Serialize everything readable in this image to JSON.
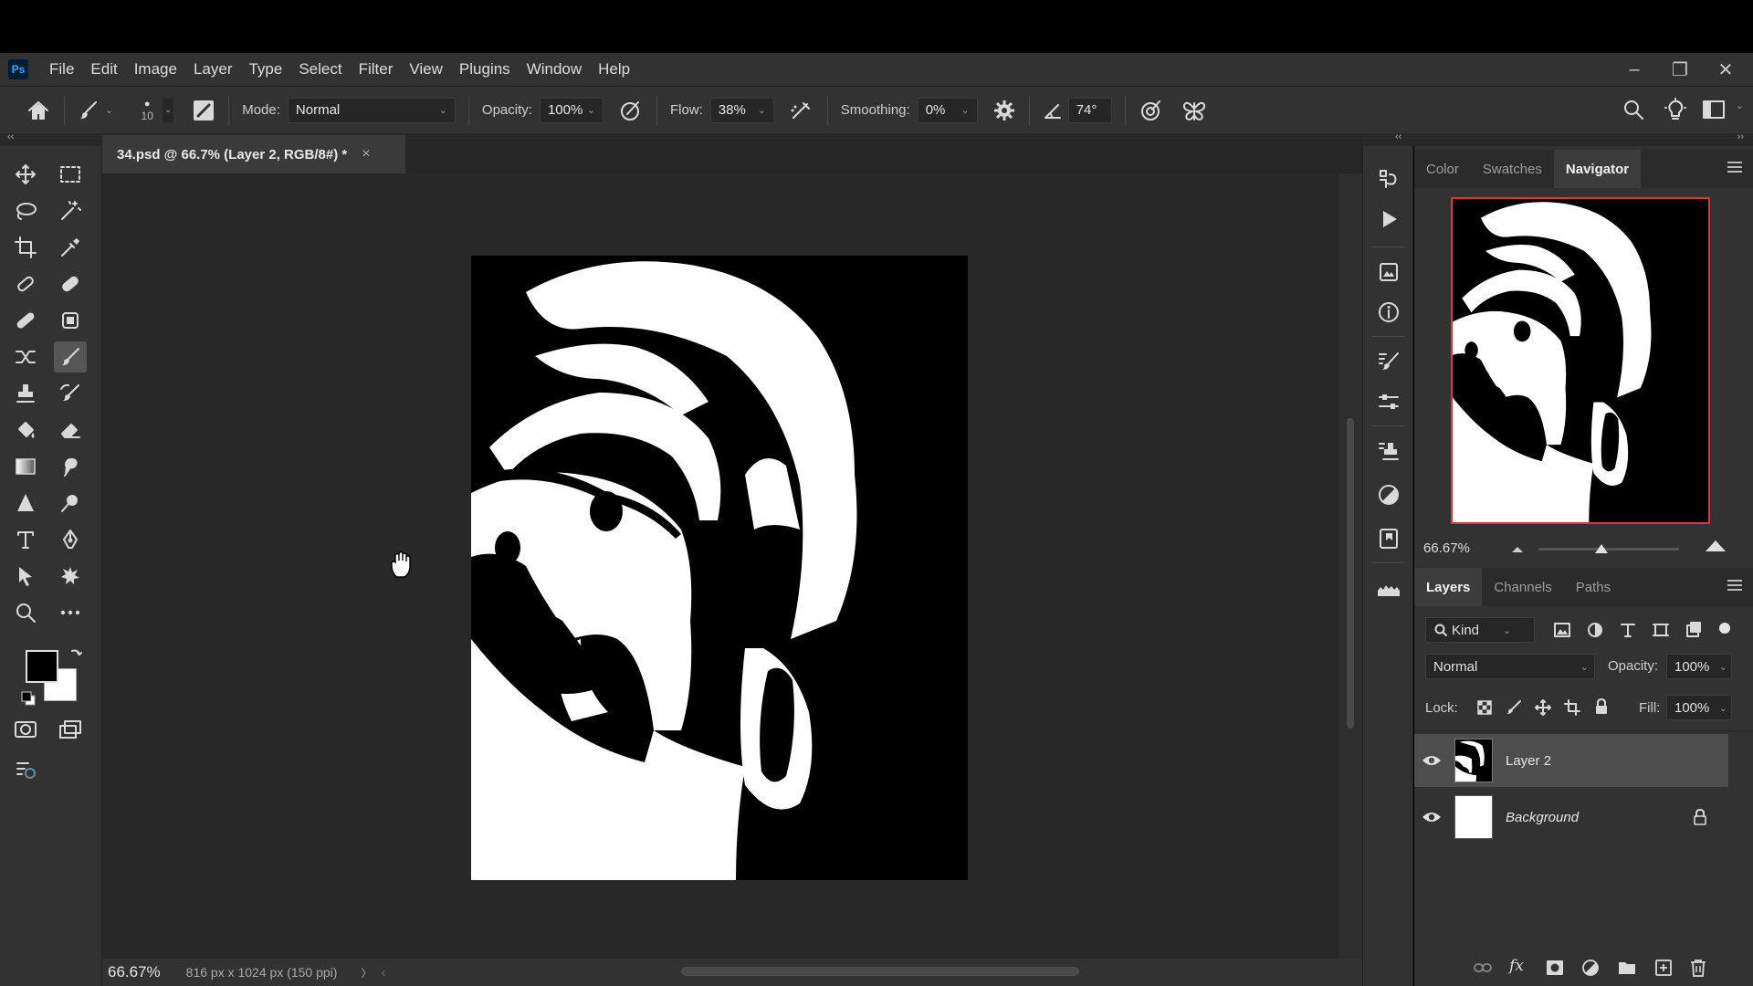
{
  "app": {
    "logo_text": "Ps",
    "menu": [
      "File",
      "Edit",
      "Image",
      "Layer",
      "Type",
      "Select",
      "Filter",
      "View",
      "Plugins",
      "Window",
      "Help"
    ]
  },
  "options": {
    "brush_size": "10",
    "mode_label": "Mode:",
    "mode_value": "Normal",
    "opacity_label": "Opacity:",
    "opacity_value": "100%",
    "flow_label": "Flow:",
    "flow_value": "38%",
    "smoothing_label": "Smoothing:",
    "smoothing_value": "0%",
    "angle_value": "74°"
  },
  "document": {
    "tab_title": "34.psd @ 66.7% (Layer 2, RGB/8#) *",
    "close_glyph": "×"
  },
  "status": {
    "zoom": "66.67%",
    "doc_info": "816 px x 1024 px (150 ppi)",
    "nav_arrow": "〉",
    "left_arrow": "‹"
  },
  "panels": {
    "top_tabs": [
      "Color",
      "Swatches",
      "Navigator"
    ],
    "navigator_zoom": "66.67%",
    "navigator_zoom_fraction": 0.45,
    "layer_tabs": [
      "Layers",
      "Channels",
      "Paths"
    ],
    "filter_kind": "Kind",
    "blend_mode": "Normal",
    "opacity_label": "Opacity:",
    "opacity_value": "100%",
    "lock_label": "Lock:",
    "fill_label": "Fill:",
    "fill_value": "100%"
  },
  "layers": [
    {
      "name": "Layer 2",
      "selected": true,
      "locked": false
    },
    {
      "name": "Background",
      "selected": false,
      "locked": true
    }
  ],
  "colors": {
    "foreground": "#000000",
    "background": "#ffffff",
    "navigator_frame": "#e2343e"
  }
}
